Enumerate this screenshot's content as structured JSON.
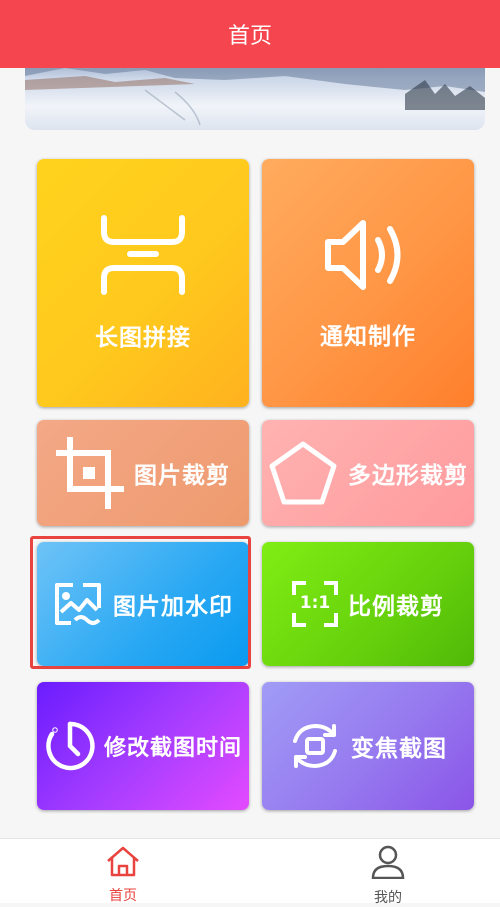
{
  "header": {
    "title": "首页"
  },
  "tiles": [
    {
      "label": "长图拼接",
      "icon": "long-image-stitch-icon"
    },
    {
      "label": "通知制作",
      "icon": "speaker-icon"
    },
    {
      "label": "图片裁剪",
      "icon": "crop-icon"
    },
    {
      "label": "多边形裁剪",
      "icon": "pentagon-icon"
    },
    {
      "label": "图片加水印",
      "icon": "watermark-image-icon",
      "selected": true
    },
    {
      "label": "比例裁剪",
      "icon": "ratio-1-1-icon",
      "ratio_text": "1:1"
    },
    {
      "label": "修改截图时间",
      "icon": "clock-icon"
    },
    {
      "label": "变焦截图",
      "icon": "zoom-rotate-icon"
    }
  ],
  "tabbar": {
    "home": {
      "label": "首页",
      "icon": "home-icon",
      "active": true
    },
    "mine": {
      "label": "我的",
      "icon": "user-icon",
      "active": false
    }
  },
  "colors": {
    "header": "#f5454e",
    "active_tab": "#e8433f",
    "inactive_tab": "#555555",
    "selection_frame": "#e8433f"
  }
}
